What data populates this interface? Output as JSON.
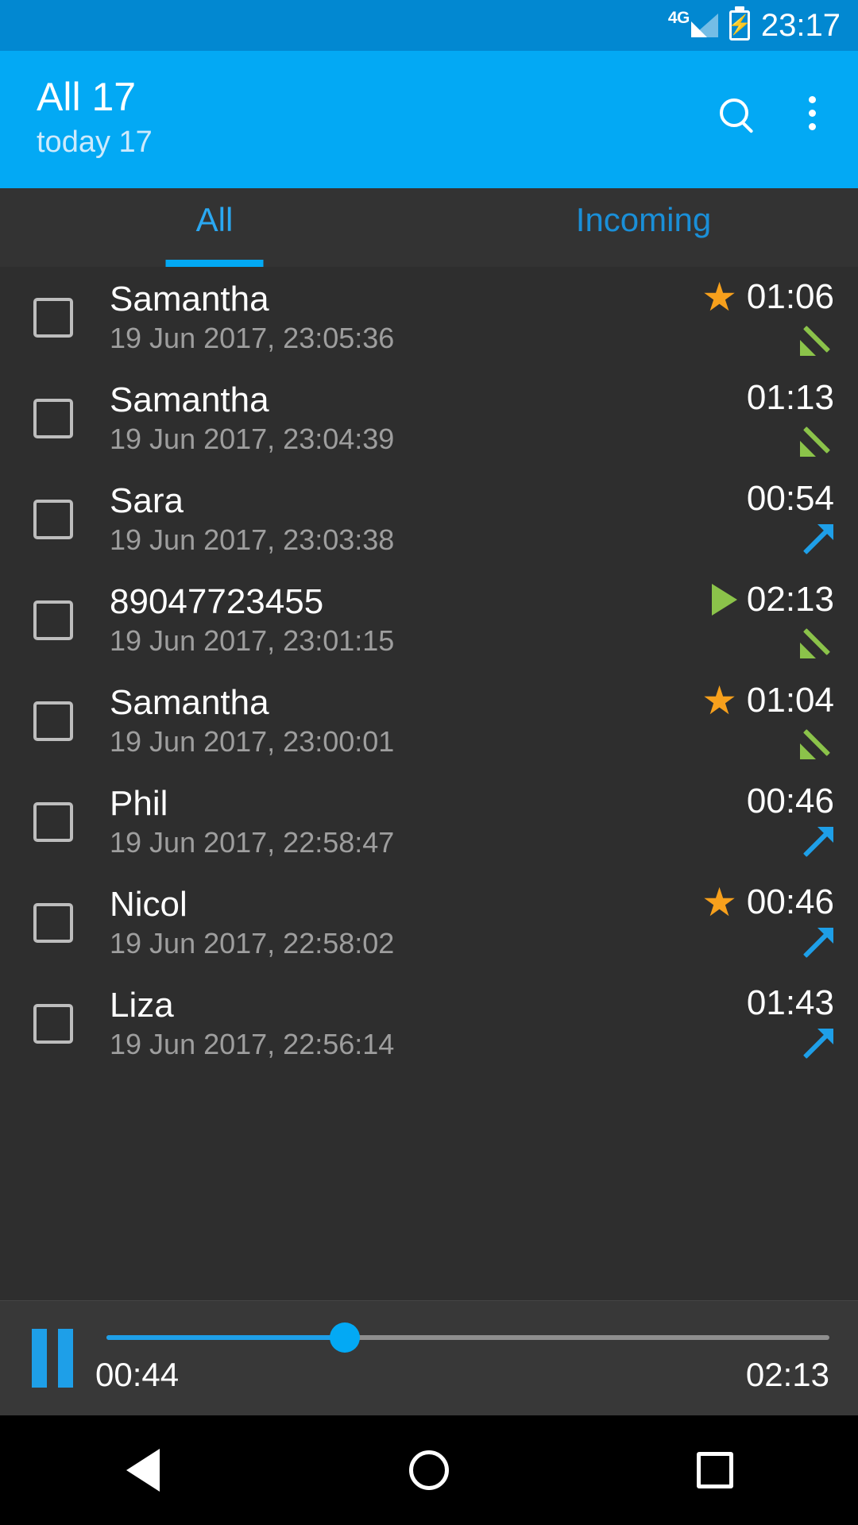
{
  "status_bar": {
    "network_label": "4G",
    "battery_icon": "battery-charging-icon",
    "signal_icon": "signal-bars-icon",
    "time": "23:17",
    "background_color": "#0288D1"
  },
  "app_bar": {
    "title": "All 17",
    "subtitle": "today 17",
    "background_color": "#03A9F4",
    "search_label": "search-icon",
    "overflow_label": "more-options-icon"
  },
  "tabs": {
    "active_index": 0,
    "indicator_color": "#03A9F4",
    "items": [
      {
        "label": "All",
        "active": true
      },
      {
        "label": "Incoming",
        "active": false
      }
    ]
  },
  "call_list": {
    "background_color": "#2E2E2E",
    "rows": [
      {
        "name": "Samantha",
        "datetime": "19 Jun 2017, 23:05:36",
        "duration": "01:06",
        "starred": true,
        "playing": false,
        "direction": "incoming"
      },
      {
        "name": "Samantha",
        "datetime": "19 Jun 2017, 23:04:39",
        "duration": "01:13",
        "starred": false,
        "playing": false,
        "direction": "incoming"
      },
      {
        "name": "Sara",
        "datetime": "19 Jun 2017, 23:03:38",
        "duration": "00:54",
        "starred": false,
        "playing": false,
        "direction": "outgoing"
      },
      {
        "name": "89047723455",
        "datetime": "19 Jun 2017, 23:01:15",
        "duration": "02:13",
        "starred": false,
        "playing": true,
        "direction": "incoming"
      },
      {
        "name": "Samantha",
        "datetime": "19 Jun 2017, 23:00:01",
        "duration": "01:04",
        "starred": true,
        "playing": false,
        "direction": "incoming"
      },
      {
        "name": "Phil",
        "datetime": "19 Jun 2017, 22:58:47",
        "duration": "00:46",
        "starred": false,
        "playing": false,
        "direction": "outgoing"
      },
      {
        "name": "Nicol",
        "datetime": "19 Jun 2017, 22:58:02",
        "duration": "00:46",
        "starred": true,
        "playing": false,
        "direction": "outgoing"
      },
      {
        "name": "Liza",
        "datetime": "19 Jun 2017, 22:56:14",
        "duration": "01:43",
        "starred": false,
        "playing": false,
        "direction": "outgoing"
      }
    ],
    "star_color": "#F7A01C",
    "incoming_color": "#8BC34A",
    "outgoing_color": "#1E9FE8",
    "star_glyph": "★"
  },
  "player": {
    "state_icon": "pause-icon",
    "position": "00:44",
    "total": "02:13",
    "progress_percent": 33,
    "accent_color": "#03A9F4"
  },
  "nav_bar": {
    "back": "back-icon",
    "home": "home-icon",
    "recents": "recents-icon"
  }
}
